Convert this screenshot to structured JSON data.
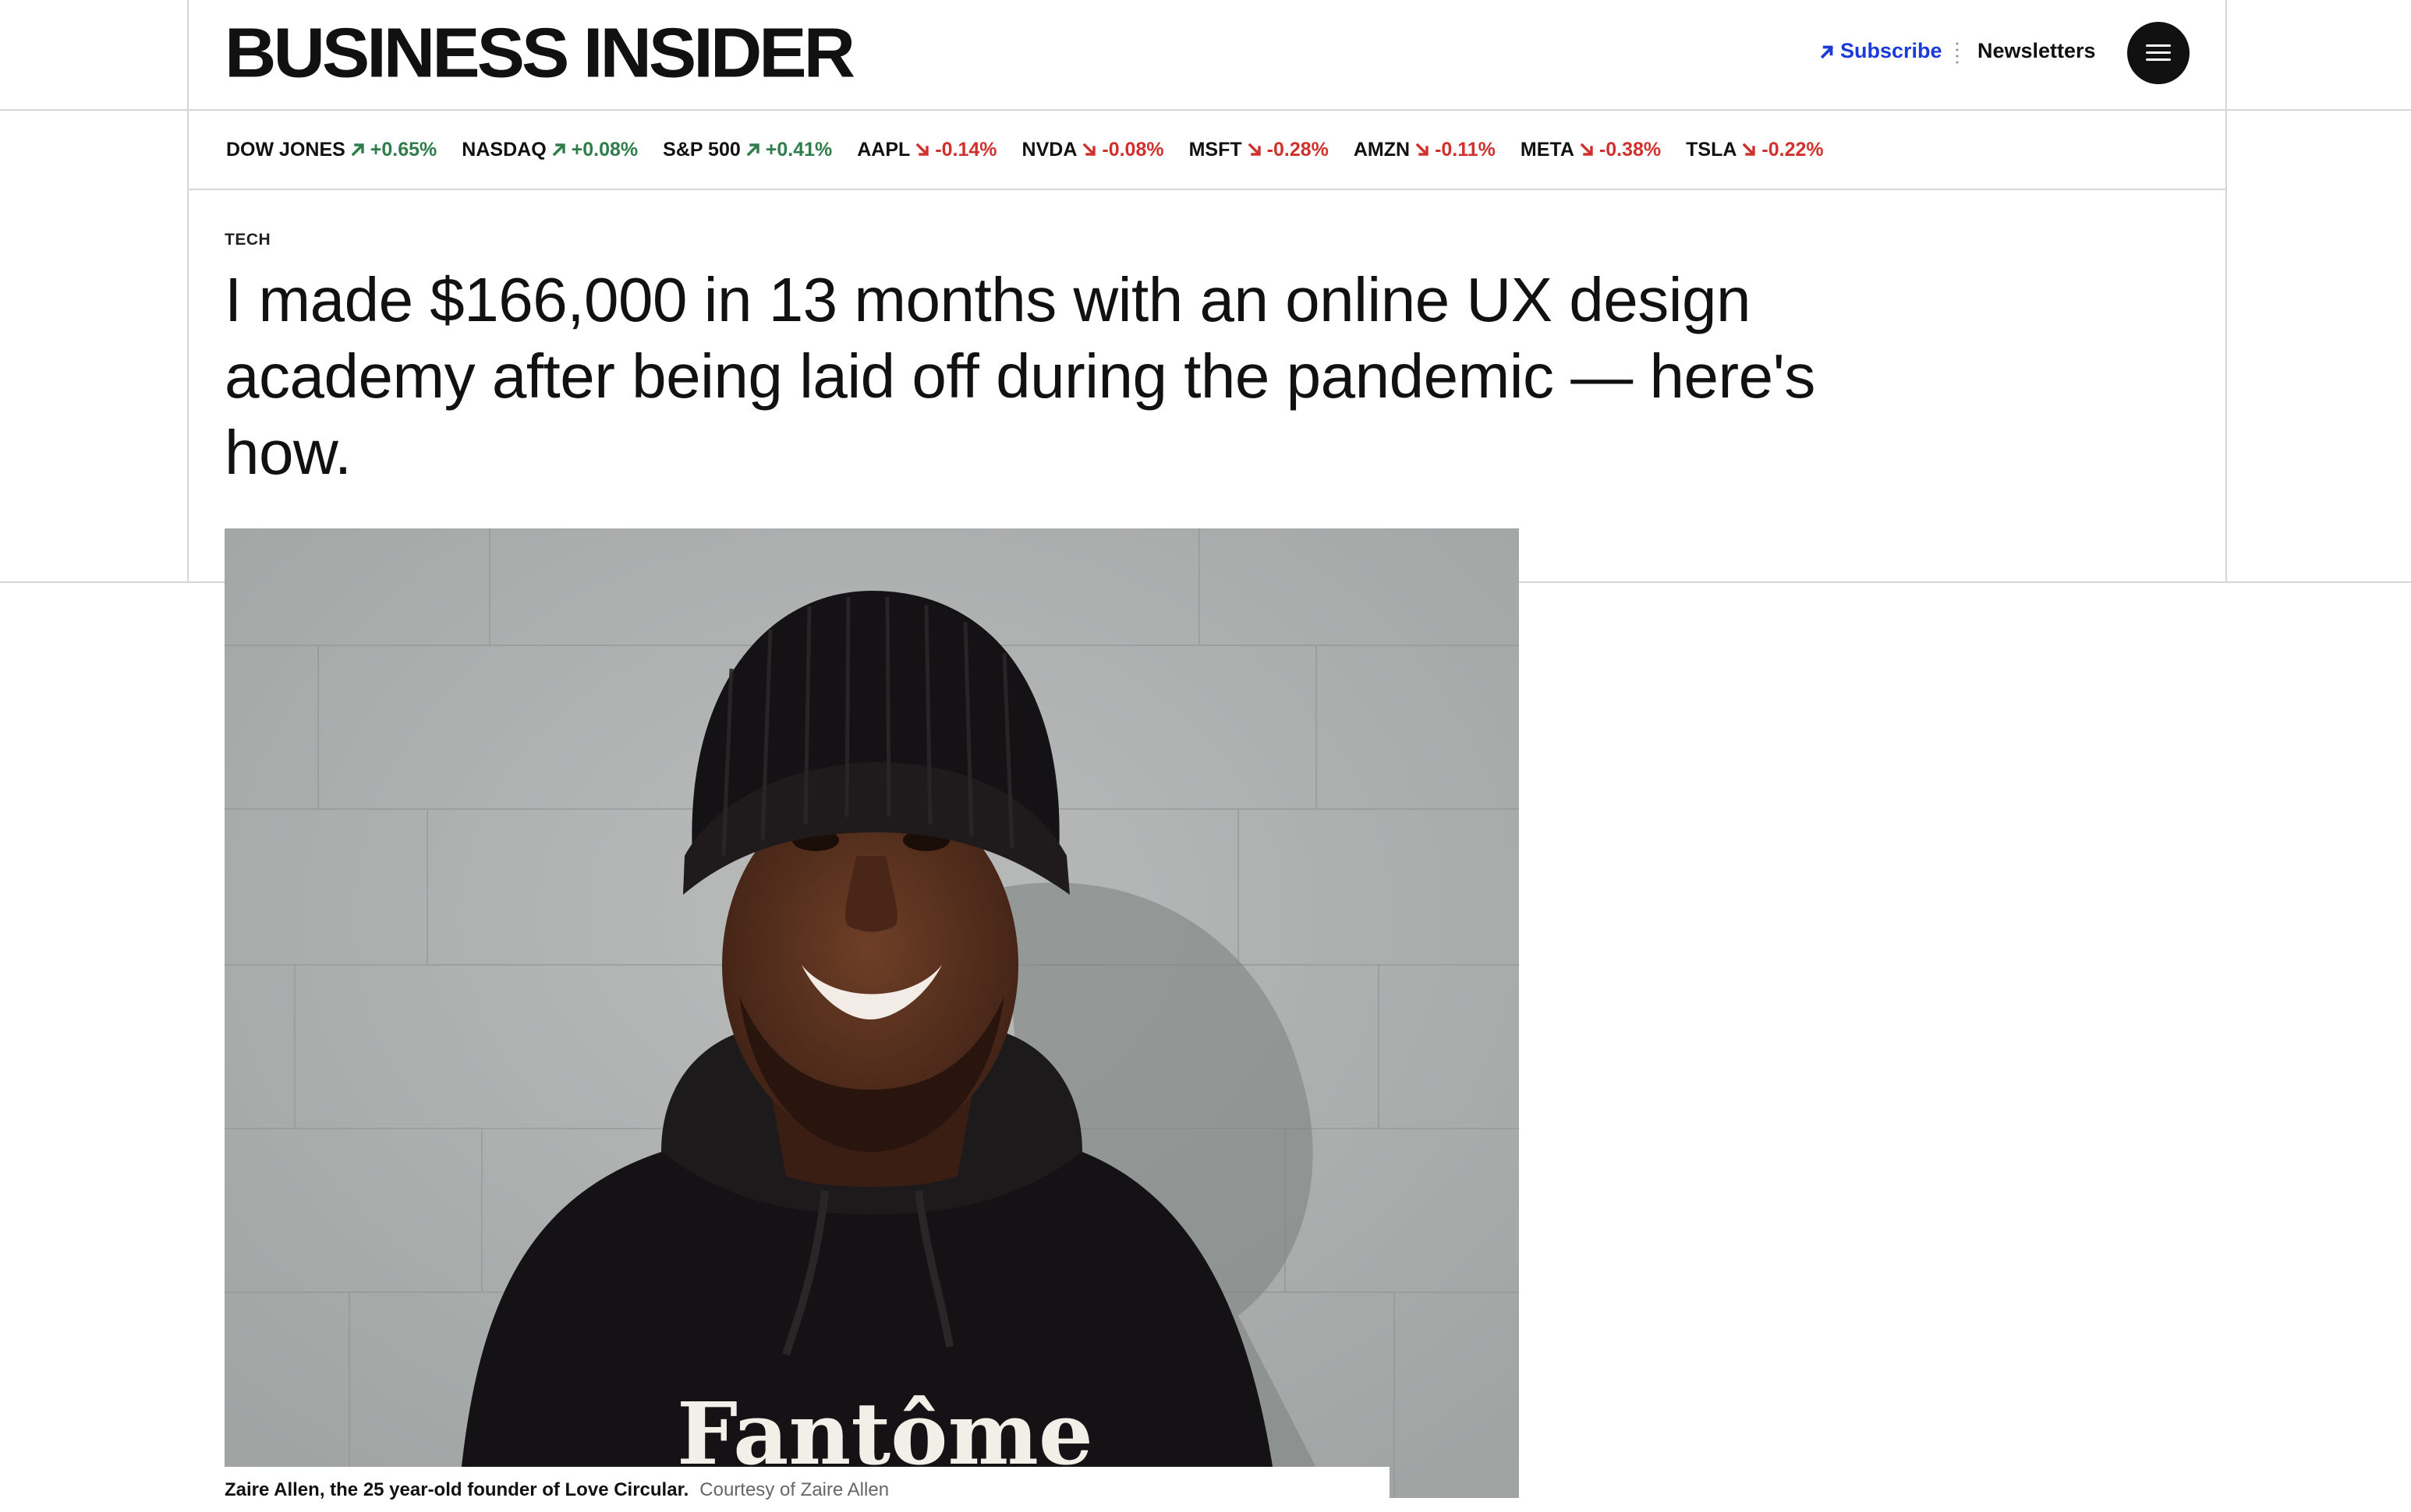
{
  "header": {
    "logo": "BUSINESS INSIDER",
    "subscribe_label": "Subscribe",
    "newsletters_label": "Newsletters",
    "menu_icon": "hamburger-menu-icon"
  },
  "ticker": [
    {
      "name": "DOW JONES",
      "change": "+0.65%",
      "direction": "up"
    },
    {
      "name": "NASDAQ",
      "change": "+0.08%",
      "direction": "up"
    },
    {
      "name": "S&P 500",
      "change": "+0.41%",
      "direction": "up"
    },
    {
      "name": "AAPL",
      "change": "-0.14%",
      "direction": "down"
    },
    {
      "name": "NVDA",
      "change": "-0.08%",
      "direction": "down"
    },
    {
      "name": "MSFT",
      "change": "-0.28%",
      "direction": "down"
    },
    {
      "name": "AMZN",
      "change": "-0.11%",
      "direction": "down"
    },
    {
      "name": "META",
      "change": "-0.38%",
      "direction": "down"
    },
    {
      "name": "TSLA",
      "change": "-0.22%",
      "direction": "down"
    }
  ],
  "article": {
    "category": "TECH",
    "headline": "I made $166,000 in 13 months with an online UX design academy after being laid off during the pandemic — here's how.",
    "image": {
      "shirt_text": "Fantôme",
      "caption": "Zaire Allen, the 25 year-old founder of Love Circular.",
      "credit": "Courtesy of Zaire Allen"
    }
  },
  "colors": {
    "subscribe": "#1b3ad9",
    "up": "#2f7d4a",
    "down": "#d0312d",
    "text": "#111111"
  }
}
